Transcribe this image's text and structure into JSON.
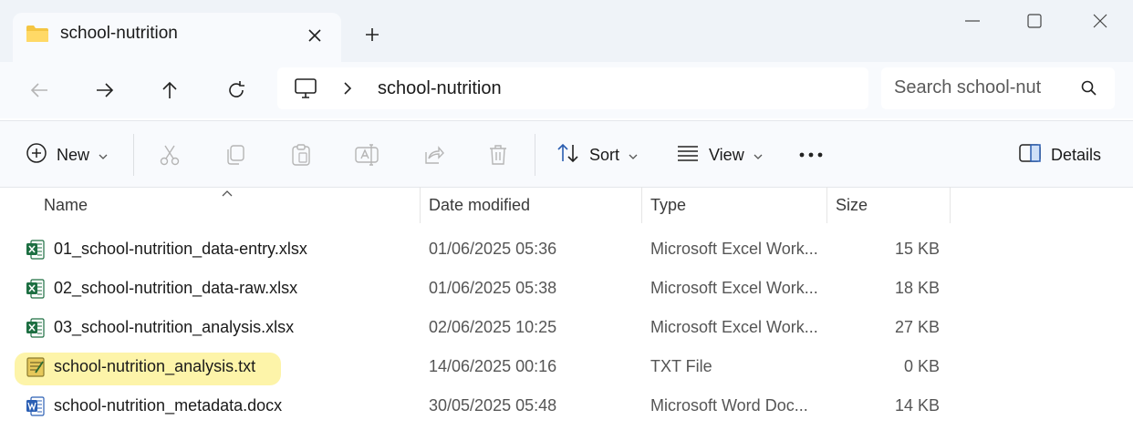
{
  "window": {
    "tab_title": "school-nutrition",
    "icons": {
      "folder": "folder-icon",
      "close_tab": "close-icon",
      "new_tab": "plus-icon",
      "minimize": "minimize-icon",
      "maximize": "maximize-icon",
      "close_window": "close-icon"
    }
  },
  "nav": {
    "breadcrumb_folder": "school-nutrition",
    "search_placeholder": "Search school-nut"
  },
  "toolbar": {
    "new_label": "New",
    "sort_label": "Sort",
    "view_label": "View",
    "details_label": "Details"
  },
  "columns": {
    "name": "Name",
    "date": "Date modified",
    "type": "Type",
    "size": "Size"
  },
  "files": [
    {
      "name": "01_school-nutrition_data-entry.xlsx",
      "date": "01/06/2025 05:36",
      "type": "Microsoft Excel Work...",
      "size": "15 KB",
      "icon": "excel-icon"
    },
    {
      "name": "02_school-nutrition_data-raw.xlsx",
      "date": "01/06/2025 05:38",
      "type": "Microsoft Excel Work...",
      "size": "18 KB",
      "icon": "excel-icon"
    },
    {
      "name": "03_school-nutrition_analysis.xlsx",
      "date": "02/06/2025 10:25",
      "type": "Microsoft Excel Work...",
      "size": "27 KB",
      "icon": "excel-icon"
    },
    {
      "name": "school-nutrition_analysis.txt",
      "date": "14/06/2025 00:16",
      "type": "TXT File",
      "size": "0 KB",
      "icon": "text-file-icon",
      "highlighted": true
    },
    {
      "name": "school-nutrition_metadata.docx",
      "date": "30/05/2025 05:48",
      "type": "Microsoft Word Doc...",
      "size": "14 KB",
      "icon": "word-icon"
    }
  ],
  "colors": {
    "highlight": "#fdf29a",
    "excel": "#1d6f42",
    "word": "#2b5fb4",
    "chrome": "#eff3f8"
  }
}
